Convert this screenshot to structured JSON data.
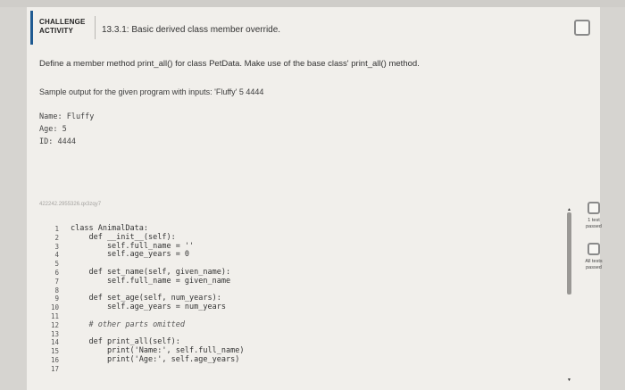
{
  "header": {
    "badge_line1": "CHALLENGE",
    "badge_line2": "ACTIVITY",
    "title": "13.3.1: Basic derived class member override."
  },
  "description": "Define a member method print_all() for class PetData. Make use of the base class' print_all() method.",
  "sample_intro": "Sample output for the given program with inputs: 'Fluffy' 5 4444",
  "sample_output": [
    "Name: Fluffy",
    "Age: 5",
    "ID: 4444"
  ],
  "activity_id": "422242.2955326.qx3zqy7",
  "editor": {
    "line_numbers": [
      "1",
      "2",
      "3",
      "4",
      "5",
      "6",
      "7",
      "8",
      "9",
      "10",
      "11",
      "12",
      "13",
      "14",
      "15",
      "16",
      "17"
    ],
    "lines": [
      "class AnimalData:",
      "    def __init__(self):",
      "        self.full_name = ''",
      "        self.age_years = 0",
      "",
      "    def set_name(self, given_name):",
      "        self.full_name = given_name",
      "",
      "    def set_age(self, num_years):",
      "        self.age_years = num_years",
      "",
      "    # other parts omitted",
      "",
      "    def print_all(self):",
      "        print('Name:', self.full_name)",
      "        print('Age:', self.age_years)",
      ""
    ]
  },
  "status": {
    "test1_line1": "1 test",
    "test1_line2": "passed",
    "test2_line1": "All tests",
    "test2_line2": "passed"
  },
  "colors": {
    "accent": "#1f5a91",
    "panel": "#f1efeb",
    "background": "#d6d4d0"
  }
}
